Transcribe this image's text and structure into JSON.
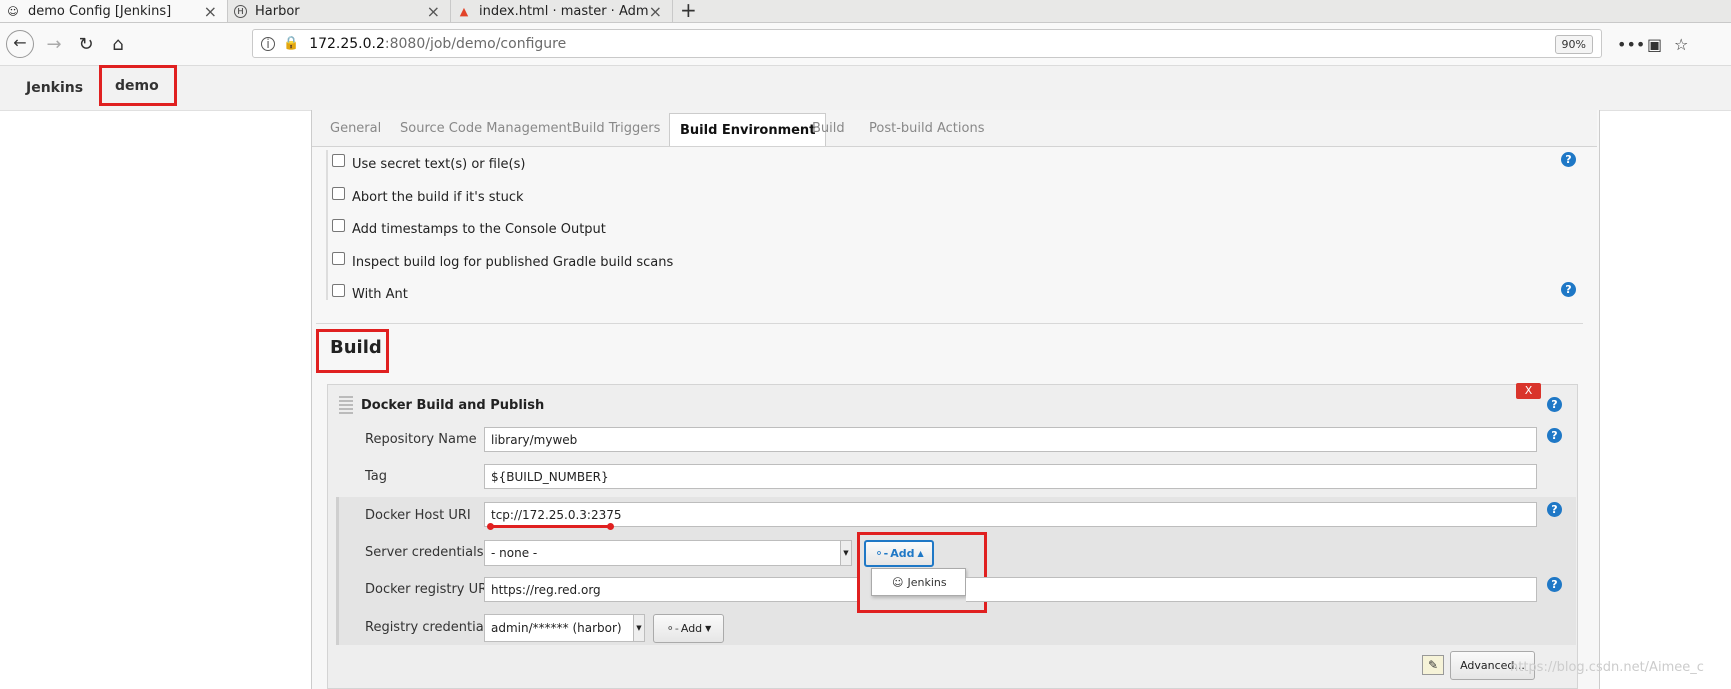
{
  "browser": {
    "tabs": [
      {
        "title": "demo Config [Jenkins]",
        "icon": "jenkins-icon"
      },
      {
        "title": "Harbor",
        "icon": "harbor-icon"
      },
      {
        "title": "index.html · master · Adm",
        "icon": "gitlab-icon"
      }
    ],
    "url_host": "172.25.0.2",
    "url_path": ":8080/job/demo/configure",
    "zoom": "90%"
  },
  "breadcrumb": {
    "root": "Jenkins",
    "job": "demo"
  },
  "config_tabs": [
    "General",
    "Source Code Management",
    "Build Triggers",
    "Build Environment",
    "Build",
    "Post-build Actions"
  ],
  "selected_tab": "Build Environment",
  "build_env_options": [
    "Use secret text(s) or file(s)",
    "Abort the build if it's stuck",
    "Add timestamps to the Console Output",
    "Inspect build log for published Gradle build scans",
    "With Ant"
  ],
  "build": {
    "section_title": "Build",
    "step_title": "Docker Build and Publish",
    "delete_label": "X",
    "fields": {
      "repository_name": {
        "label": "Repository Name",
        "value": "library/myweb"
      },
      "tag": {
        "label": "Tag",
        "value": "${BUILD_NUMBER}"
      },
      "docker_host_uri": {
        "label": "Docker Host URI",
        "value": "tcp://172.25.0.3:2375"
      },
      "server_credentials": {
        "label": "Server credentials",
        "value": "- none -"
      },
      "docker_registry_url": {
        "label": "Docker registry URL",
        "value": "https://reg.red.org"
      },
      "registry_credentials": {
        "label": "Registry credentials",
        "value": "admin/****** (harbor)"
      }
    },
    "add_label": "Add",
    "add_menu_item": "Jenkins",
    "advanced_label": "Advanced..."
  },
  "watermark": "https://blog.csdn.net/Aimee_c",
  "colors": {
    "highlight": "#e02020",
    "help": "#1f78c6",
    "delete": "#d9342b"
  }
}
